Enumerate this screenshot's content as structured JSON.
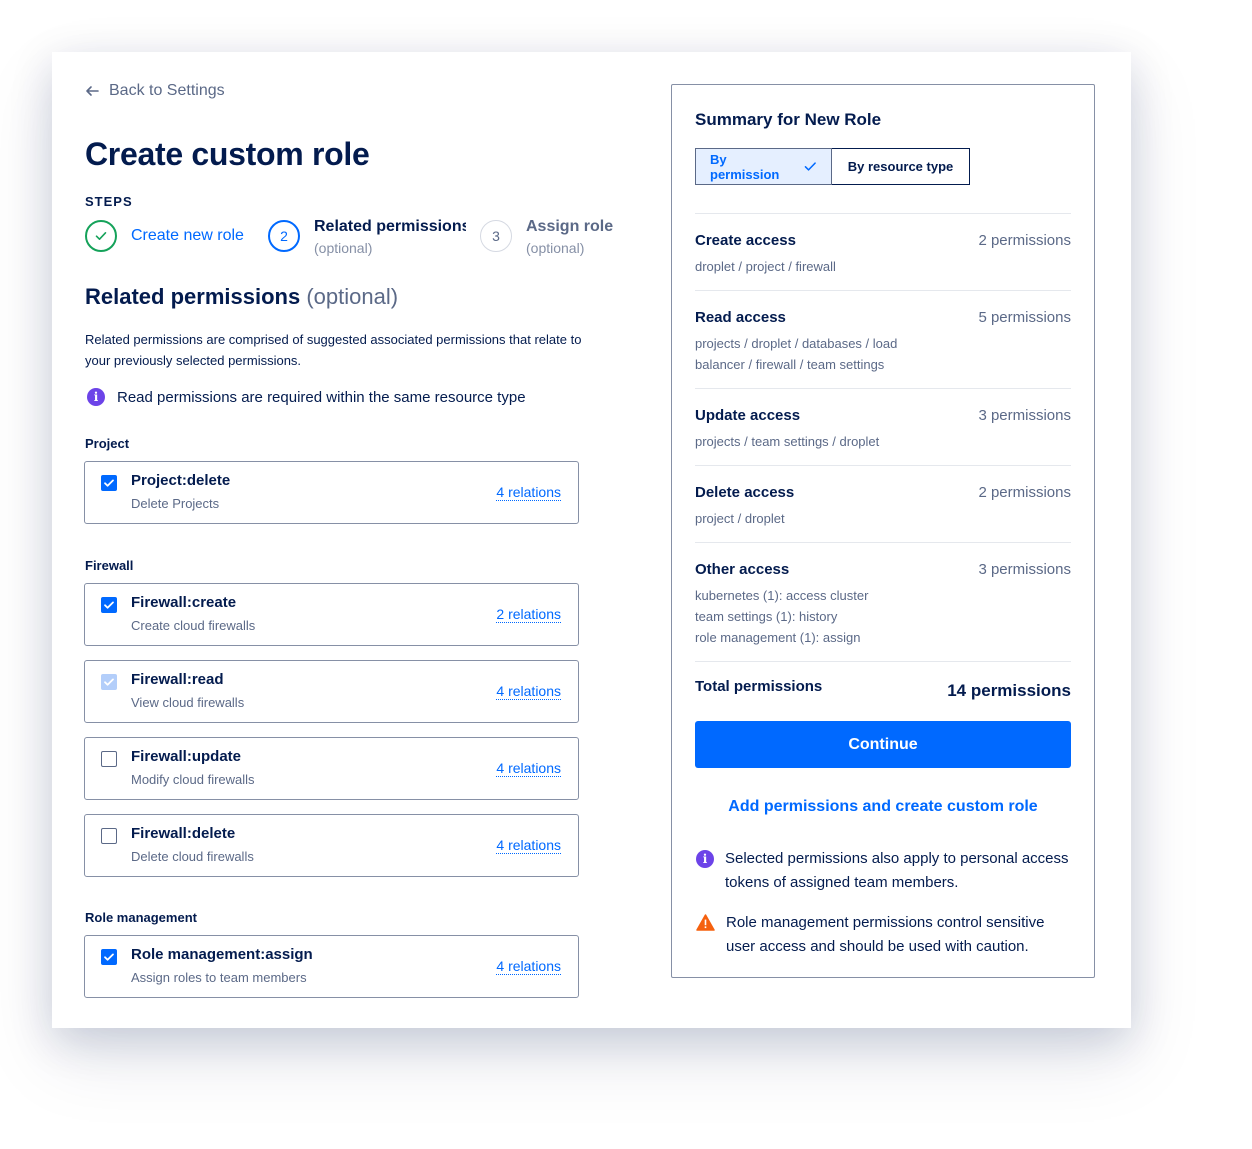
{
  "nav": {
    "back_label": "Back to Settings"
  },
  "page": {
    "title": "Create custom role",
    "steps_label": "STEPS"
  },
  "steps": [
    {
      "label": "Create new role",
      "sub": ""
    },
    {
      "number": "2",
      "label": "Related permissions",
      "sub": "(optional)"
    },
    {
      "number": "3",
      "label": "Assign role",
      "sub": "(optional)"
    }
  ],
  "section": {
    "title": "Related permissions",
    "title_optional": "(optional)",
    "description": "Related permissions are comprised of suggested associated permissions that relate to your previously selected permissions.",
    "info": "Read permissions are required within the same resource type"
  },
  "groups": {
    "project": "Project",
    "firewall": "Firewall",
    "role_management": "Role management"
  },
  "permissions": [
    {
      "name": "Project:delete",
      "desc": "Delete Projects",
      "relations": "4 relations",
      "state": "checked"
    },
    {
      "name": "Firewall:create",
      "desc": "Create cloud firewalls",
      "relations": "2 relations",
      "state": "checked"
    },
    {
      "name": "Firewall:read",
      "desc": "View cloud firewalls",
      "relations": "4 relations",
      "state": "checked-disabled"
    },
    {
      "name": "Firewall:update",
      "desc": "Modify cloud firewalls",
      "relations": "4 relations",
      "state": "unchecked"
    },
    {
      "name": "Firewall:delete",
      "desc": "Delete cloud firewalls",
      "relations": "4 relations",
      "state": "unchecked"
    },
    {
      "name": "Role management:assign",
      "desc": "Assign roles to team members",
      "relations": "4 relations",
      "state": "checked"
    }
  ],
  "summary": {
    "title": "Summary for New Role",
    "toggle": {
      "by_permission": "By permission",
      "by_resource": "By resource type",
      "selected": "By permission"
    },
    "rows": [
      {
        "title": "Create access",
        "count": "2 permissions",
        "detail": [
          "droplet / project / firewall"
        ]
      },
      {
        "title": "Read access",
        "count": "5 permissions",
        "detail": [
          "projects / droplet / databases / load",
          "balancer / firewall / team settings"
        ]
      },
      {
        "title": "Update access",
        "count": "3 permissions",
        "detail": [
          "projects / team settings / droplet"
        ]
      },
      {
        "title": "Delete access",
        "count": "2 permissions",
        "detail": [
          "project / droplet"
        ]
      },
      {
        "title": "Other access",
        "count": "3 permissions",
        "detail": [
          "kubernetes (1): access cluster",
          "team settings (1): history",
          "role management (1): assign"
        ]
      }
    ],
    "total_label": "Total permissions",
    "total_value": "14 permissions",
    "continue_label": "Continue",
    "add_link": "Add permissions and create custom role",
    "notes": [
      {
        "icon": "info-icon",
        "text": "Selected permissions also apply to personal access tokens of assigned team members."
      },
      {
        "icon": "warning-icon",
        "text": "Role management permissions control sensitive user access and should be used with caution."
      }
    ]
  },
  "colors": {
    "primary": "#0069ff",
    "success": "#15a25a",
    "navy": "#031b4e",
    "muted": "#5b6987",
    "info": "#6c43e8",
    "warning": "#f5610f"
  }
}
